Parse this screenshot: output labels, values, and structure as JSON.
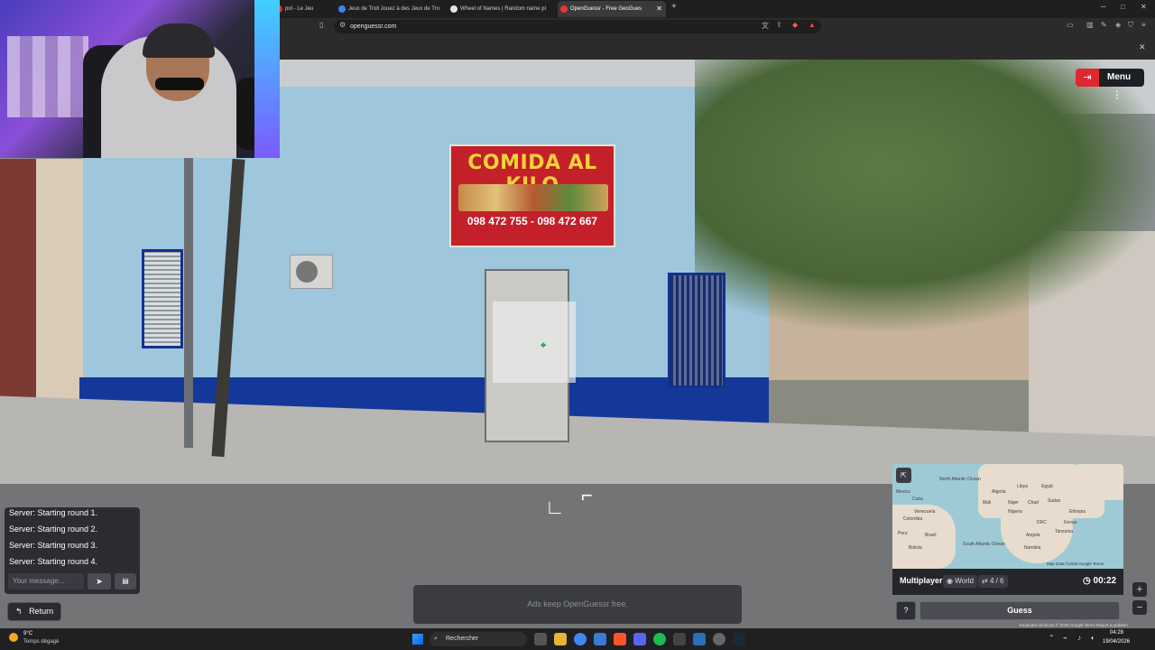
{
  "browser": {
    "tabs": [
      {
        "title": "pol - Le Jeu",
        "active": false
      },
      {
        "title": "Jeux de Troll Jouez à des Jeux de Tro",
        "active": false
      },
      {
        "title": "Wheel of Names | Random name pi",
        "active": false
      },
      {
        "title": "OpenGuessr - Free GeoGues",
        "active": true
      }
    ],
    "url": "openguessr.com"
  },
  "scene": {
    "sign_title": "COMIDA AL KILO",
    "sign_phone": "098 472 755 - 098 472 667"
  },
  "game": {
    "menu_label": "Menu",
    "chat": {
      "messages": [
        "Server: Starting round 1.",
        "Server: Starting round 2.",
        "Server: Starting round 3.",
        "Server: Starting round 4."
      ],
      "placeholder": "Your message..."
    },
    "return_label": "Return",
    "ads_text": "Ads keep OpenGuessr free.",
    "minimap": {
      "mode": "Multiplayer",
      "region": "World",
      "round": "4 / 6",
      "timer": "00:22",
      "guess_label": "Guess",
      "help_label": "?",
      "attribution": "Map Data ©2026 Google   Terms",
      "footer": "Keyboard shortcuts   © 2026 Google   Terms   Report a problem",
      "labels": [
        "North Atlantic Ocean",
        "Libya",
        "Egypt",
        "Algeria",
        "Mali",
        "Niger",
        "Chad",
        "Sudan",
        "Nigeria",
        "Ethiopia",
        "Kenya",
        "DRC",
        "Angola",
        "Tanzania",
        "Namibia",
        "South Atlantic Ocean",
        "Colombia",
        "Peru",
        "Brazil",
        "Bolivia",
        "Venezuela",
        "Mexico",
        "Cuba"
      ]
    }
  },
  "taskbar": {
    "weather_temp": "9°C",
    "weather_desc": "Temps dégagé",
    "search_label": "Rechercher",
    "time": "04:28",
    "date": "19/04/2026"
  },
  "colors": {
    "exit_red": "#e0262e",
    "wall_blue": "#14389a",
    "sign_red": "#c3202a"
  }
}
